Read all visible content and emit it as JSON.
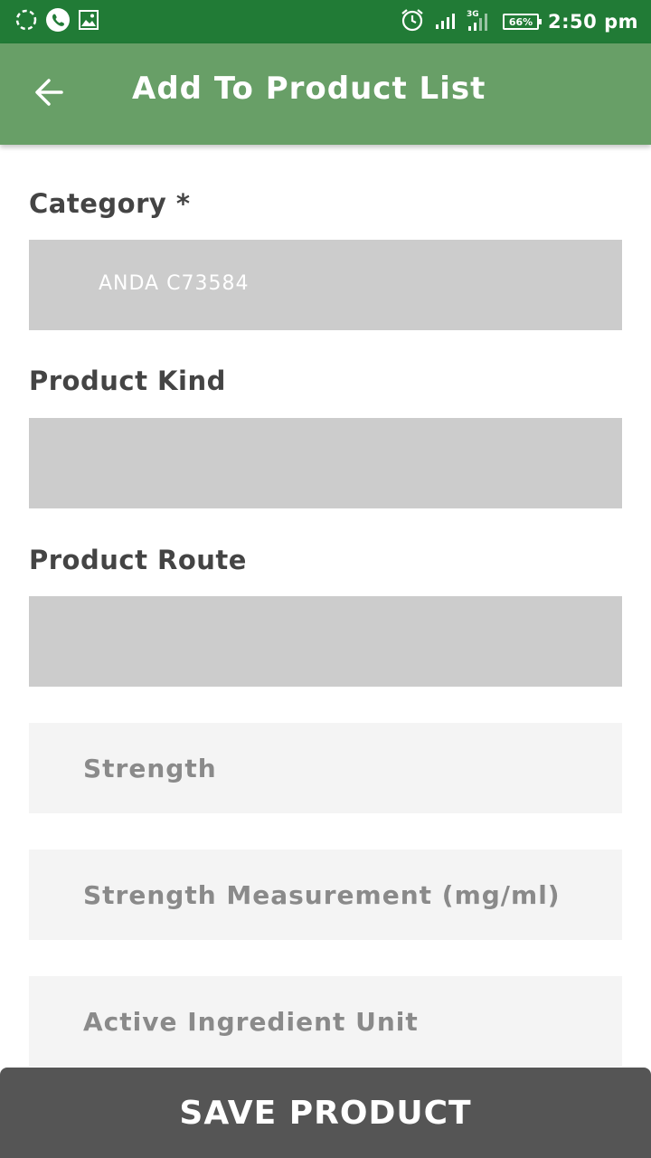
{
  "status_bar": {
    "time": "2:50 pm",
    "battery": "66%",
    "network": "3G",
    "icons": [
      "sync-icon",
      "whatsapp-icon",
      "gallery-icon",
      "alarm-icon",
      "signal-icon",
      "network-signal-icon",
      "battery-icon"
    ]
  },
  "app_bar": {
    "title": "Add To Product List",
    "back_icon": "arrow-back-icon"
  },
  "form": {
    "category_label": "Category *",
    "category_value": "ANDA C73584",
    "product_kind_label": "Product Kind",
    "product_kind_value": "",
    "product_route_label": "Product Route",
    "product_route_value": "",
    "strength_placeholder": "Strength",
    "strength_measurement_placeholder": "Strength Measurement (mg/ml)",
    "active_ingredient_placeholder": "Active Ingredient Unit"
  },
  "save_button": {
    "label": "SAVE PRODUCT"
  },
  "colors": {
    "status_bar": "#217b36",
    "app_bar": "#689f67",
    "select_bg": "#cccccc",
    "input_bg": "#f4f4f4",
    "button_bg": "#555555"
  }
}
